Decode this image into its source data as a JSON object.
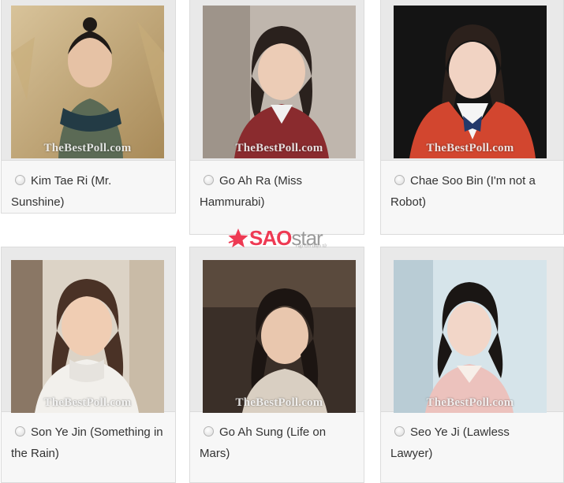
{
  "watermark": "TheBestPoll.com",
  "options": [
    {
      "name": "Kim Tae Ri (Mr. Sunshine)",
      "selected": false
    },
    {
      "name": "Go Ah Ra (Miss Hammurabi)",
      "selected": false
    },
    {
      "name": "Chae Soo Bin (I'm not a Robot)",
      "selected": false
    },
    {
      "name": "Son Ye Jin (Something in the Rain)",
      "selected": false
    },
    {
      "name": "Go Ah Sung (Life on Mars)",
      "selected": false
    },
    {
      "name": "Seo Ye Ji (Lawless Lawyer)",
      "selected": false
    }
  ],
  "logo": {
    "part1": "SAO",
    "part2": "star",
    "tagline": "Tạp chí điện tử"
  },
  "colors": {
    "brand": "#ee3a53",
    "card_bg": "#f7f7f7",
    "border": "#dcdcdc"
  }
}
